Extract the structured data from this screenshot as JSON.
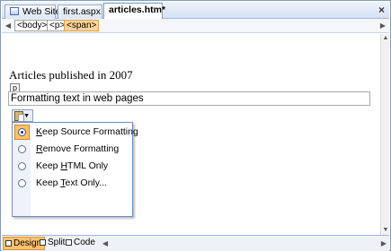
{
  "tabs": [
    {
      "label": "Web Site",
      "active": false,
      "icon": "website-icon"
    },
    {
      "label": "first.aspx",
      "active": false
    },
    {
      "label": "articles.htm*",
      "active": true
    }
  ],
  "close_glyph": "×",
  "tag_nav": {
    "tags": [
      "<body>",
      "<p>",
      "<span>"
    ],
    "selected": "<span>"
  },
  "document": {
    "heading": "Articles published in 2007",
    "p_tag": "p",
    "edit_text": "Formatting text in web pages"
  },
  "paste_options": {
    "icon": "clipboard-icon",
    "items": [
      {
        "pre": "",
        "accel": "K",
        "post": "eep Source Formatting",
        "checked": true
      },
      {
        "pre": "",
        "accel": "R",
        "post": "emove Formatting",
        "checked": false
      },
      {
        "pre": "Keep ",
        "accel": "H",
        "post": "TML Only",
        "checked": false
      },
      {
        "pre": "Keep ",
        "accel": "T",
        "post": "ext Only...",
        "checked": false
      }
    ]
  },
  "view_buttons": [
    {
      "label": "Design",
      "active": true
    },
    {
      "label": "Split",
      "active": false
    },
    {
      "label": "Code",
      "active": false
    }
  ],
  "colors": {
    "selected_tag": "#fdd49a",
    "active_view": "#fdc36e",
    "menu_border": "#6d8fc4"
  }
}
